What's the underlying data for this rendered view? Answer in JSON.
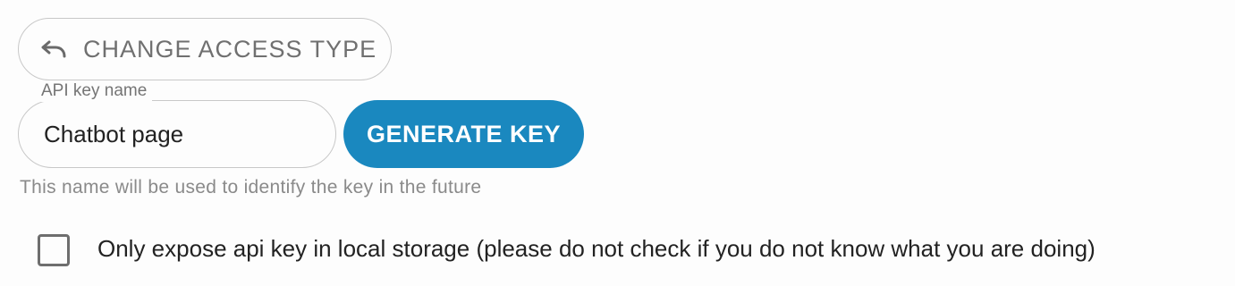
{
  "access": {
    "change_label": "CHANGE ACCESS TYPE",
    "icon": "undo-icon"
  },
  "key_form": {
    "field_label": "API key name",
    "field_value": "Chatbot page",
    "generate_label": "GENERATE KEY",
    "helper_text": "This name will be used to identify the key in the future",
    "accent_color": "#1a88bf"
  },
  "local_storage": {
    "checked": false,
    "label": "Only expose api key in local storage (please do not check if you do not know what you are doing)"
  }
}
